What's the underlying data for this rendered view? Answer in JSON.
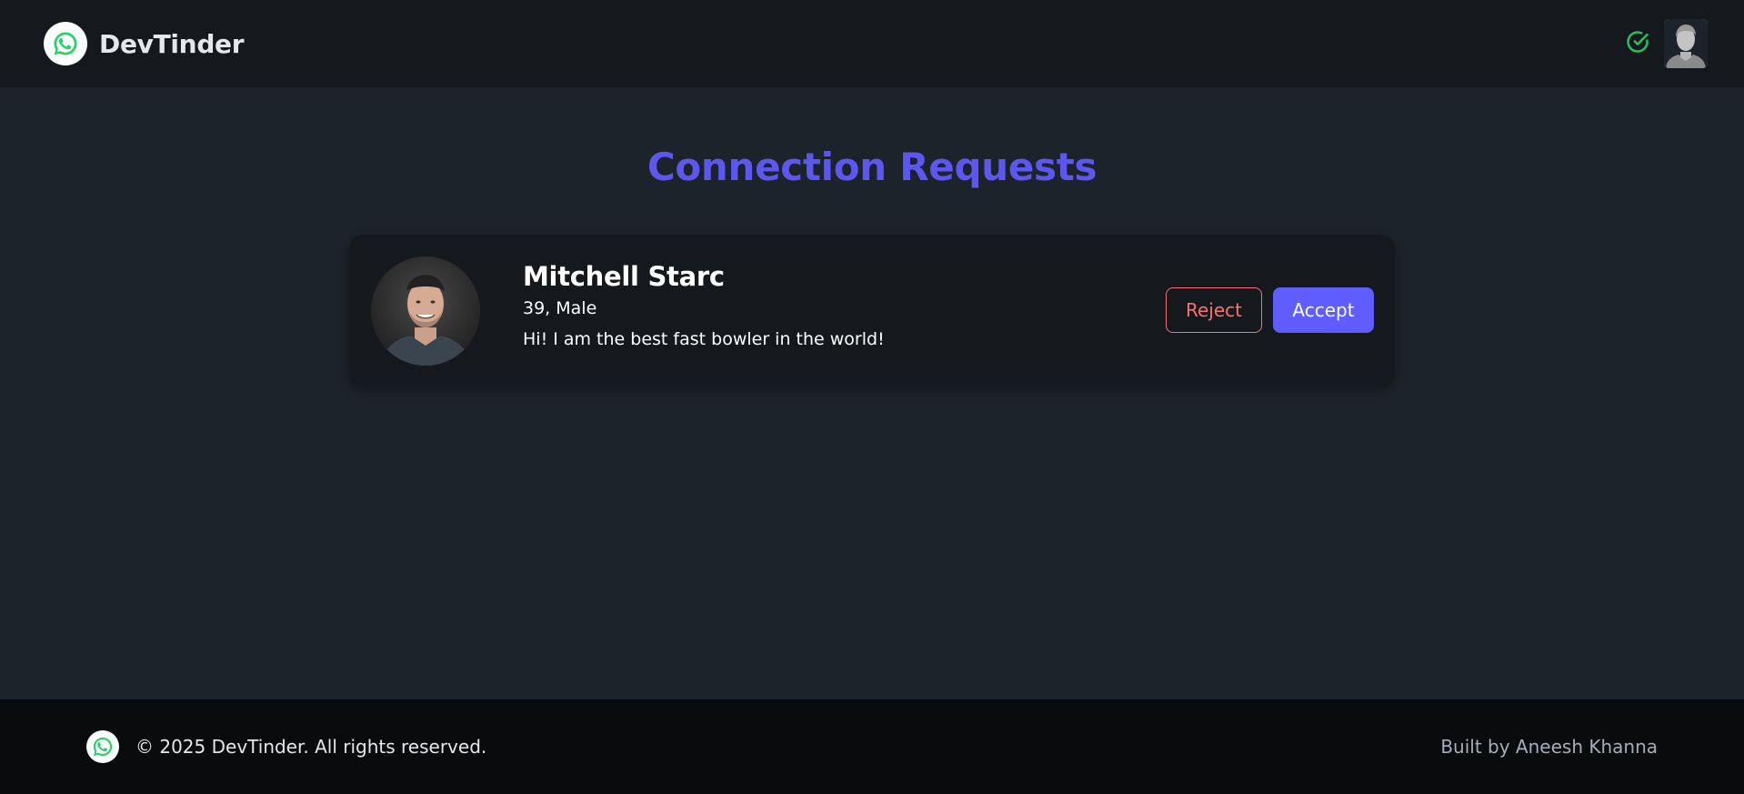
{
  "navbar": {
    "brand_name": "DevTinder",
    "logo_icon": "whatsapp-icon",
    "status_icon": "check-circle-icon",
    "status_color": "#22c55e",
    "avatar_icon": "user-avatar-icon"
  },
  "main": {
    "title": "Connection Requests",
    "title_color": "#5b57f0",
    "requests": [
      {
        "name": "Mitchell Starc",
        "meta": "39, Male",
        "about": "Hi! I am the best fast bowler in the world!",
        "reject_label": "Reject",
        "accept_label": "Accept"
      }
    ]
  },
  "footer": {
    "copyright": "© 2025 DevTinder. All rights reserved.",
    "credit": "Built by Aneesh Khanna",
    "logo_icon": "whatsapp-icon"
  },
  "colors": {
    "background": "#1d232a",
    "navbar": "#15191e",
    "footer": "#0a0b0d",
    "accent": "#605dff",
    "reject": "#f87272",
    "brand_green": "#25d366"
  }
}
